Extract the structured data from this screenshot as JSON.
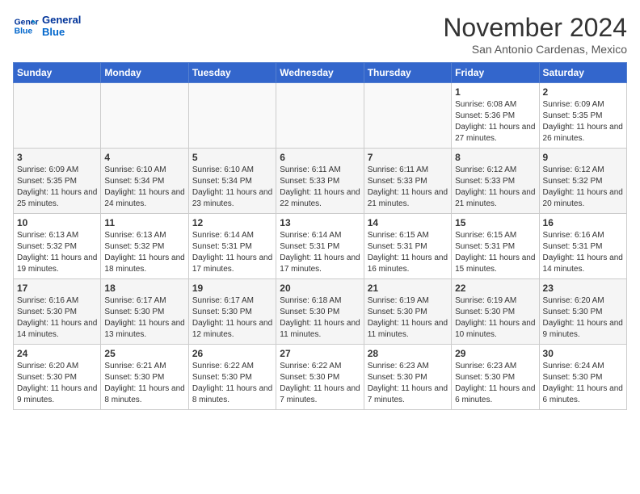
{
  "header": {
    "logo_line1": "General",
    "logo_line2": "Blue",
    "month": "November 2024",
    "location": "San Antonio Cardenas, Mexico"
  },
  "weekdays": [
    "Sunday",
    "Monday",
    "Tuesday",
    "Wednesday",
    "Thursday",
    "Friday",
    "Saturday"
  ],
  "weeks": [
    [
      {
        "day": "",
        "info": ""
      },
      {
        "day": "",
        "info": ""
      },
      {
        "day": "",
        "info": ""
      },
      {
        "day": "",
        "info": ""
      },
      {
        "day": "",
        "info": ""
      },
      {
        "day": "1",
        "info": "Sunrise: 6:08 AM\nSunset: 5:36 PM\nDaylight: 11 hours and 27 minutes."
      },
      {
        "day": "2",
        "info": "Sunrise: 6:09 AM\nSunset: 5:35 PM\nDaylight: 11 hours and 26 minutes."
      }
    ],
    [
      {
        "day": "3",
        "info": "Sunrise: 6:09 AM\nSunset: 5:35 PM\nDaylight: 11 hours and 25 minutes."
      },
      {
        "day": "4",
        "info": "Sunrise: 6:10 AM\nSunset: 5:34 PM\nDaylight: 11 hours and 24 minutes."
      },
      {
        "day": "5",
        "info": "Sunrise: 6:10 AM\nSunset: 5:34 PM\nDaylight: 11 hours and 23 minutes."
      },
      {
        "day": "6",
        "info": "Sunrise: 6:11 AM\nSunset: 5:33 PM\nDaylight: 11 hours and 22 minutes."
      },
      {
        "day": "7",
        "info": "Sunrise: 6:11 AM\nSunset: 5:33 PM\nDaylight: 11 hours and 21 minutes."
      },
      {
        "day": "8",
        "info": "Sunrise: 6:12 AM\nSunset: 5:33 PM\nDaylight: 11 hours and 21 minutes."
      },
      {
        "day": "9",
        "info": "Sunrise: 6:12 AM\nSunset: 5:32 PM\nDaylight: 11 hours and 20 minutes."
      }
    ],
    [
      {
        "day": "10",
        "info": "Sunrise: 6:13 AM\nSunset: 5:32 PM\nDaylight: 11 hours and 19 minutes."
      },
      {
        "day": "11",
        "info": "Sunrise: 6:13 AM\nSunset: 5:32 PM\nDaylight: 11 hours and 18 minutes."
      },
      {
        "day": "12",
        "info": "Sunrise: 6:14 AM\nSunset: 5:31 PM\nDaylight: 11 hours and 17 minutes."
      },
      {
        "day": "13",
        "info": "Sunrise: 6:14 AM\nSunset: 5:31 PM\nDaylight: 11 hours and 17 minutes."
      },
      {
        "day": "14",
        "info": "Sunrise: 6:15 AM\nSunset: 5:31 PM\nDaylight: 11 hours and 16 minutes."
      },
      {
        "day": "15",
        "info": "Sunrise: 6:15 AM\nSunset: 5:31 PM\nDaylight: 11 hours and 15 minutes."
      },
      {
        "day": "16",
        "info": "Sunrise: 6:16 AM\nSunset: 5:31 PM\nDaylight: 11 hours and 14 minutes."
      }
    ],
    [
      {
        "day": "17",
        "info": "Sunrise: 6:16 AM\nSunset: 5:30 PM\nDaylight: 11 hours and 14 minutes."
      },
      {
        "day": "18",
        "info": "Sunrise: 6:17 AM\nSunset: 5:30 PM\nDaylight: 11 hours and 13 minutes."
      },
      {
        "day": "19",
        "info": "Sunrise: 6:17 AM\nSunset: 5:30 PM\nDaylight: 11 hours and 12 minutes."
      },
      {
        "day": "20",
        "info": "Sunrise: 6:18 AM\nSunset: 5:30 PM\nDaylight: 11 hours and 11 minutes."
      },
      {
        "day": "21",
        "info": "Sunrise: 6:19 AM\nSunset: 5:30 PM\nDaylight: 11 hours and 11 minutes."
      },
      {
        "day": "22",
        "info": "Sunrise: 6:19 AM\nSunset: 5:30 PM\nDaylight: 11 hours and 10 minutes."
      },
      {
        "day": "23",
        "info": "Sunrise: 6:20 AM\nSunset: 5:30 PM\nDaylight: 11 hours and 9 minutes."
      }
    ],
    [
      {
        "day": "24",
        "info": "Sunrise: 6:20 AM\nSunset: 5:30 PM\nDaylight: 11 hours and 9 minutes."
      },
      {
        "day": "25",
        "info": "Sunrise: 6:21 AM\nSunset: 5:30 PM\nDaylight: 11 hours and 8 minutes."
      },
      {
        "day": "26",
        "info": "Sunrise: 6:22 AM\nSunset: 5:30 PM\nDaylight: 11 hours and 8 minutes."
      },
      {
        "day": "27",
        "info": "Sunrise: 6:22 AM\nSunset: 5:30 PM\nDaylight: 11 hours and 7 minutes."
      },
      {
        "day": "28",
        "info": "Sunrise: 6:23 AM\nSunset: 5:30 PM\nDaylight: 11 hours and 7 minutes."
      },
      {
        "day": "29",
        "info": "Sunrise: 6:23 AM\nSunset: 5:30 PM\nDaylight: 11 hours and 6 minutes."
      },
      {
        "day": "30",
        "info": "Sunrise: 6:24 AM\nSunset: 5:30 PM\nDaylight: 11 hours and 6 minutes."
      }
    ]
  ]
}
